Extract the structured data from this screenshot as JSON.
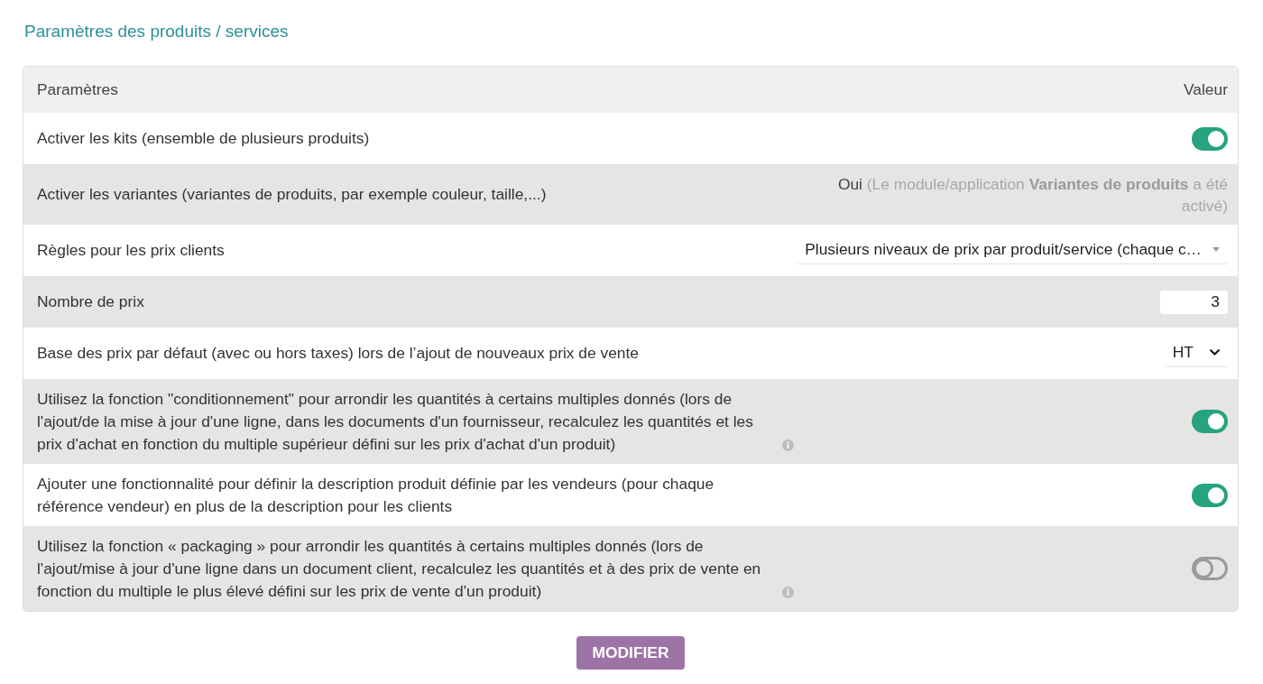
{
  "title": "Paramètres des produits / services",
  "table": {
    "columns": [
      "Paramètres",
      "Valeur"
    ],
    "rows": [
      {
        "kind": "toggle",
        "label": "Activer les kits (ensemble de plusieurs produits)",
        "on": true
      },
      {
        "kind": "status",
        "label": "Activer les variantes (variantes de produits, par exemple couleur, taille,...)",
        "value": "Oui",
        "note": "(Le module/application **Variantes de produits** a été activé)"
      },
      {
        "kind": "combobox",
        "label": "Règles pour les prix clients",
        "value": "Plusieurs niveaux de prix par produit/service (chaque c…"
      },
      {
        "kind": "number",
        "label": "Nombre de prix",
        "value": "3"
      },
      {
        "kind": "select",
        "label": "Base des prix par défaut (avec ou hors taxes) lors de l’ajout de nouveaux prix de vente",
        "value": "HT"
      },
      {
        "kind": "toggle",
        "label": "Utilisez la fonction \"conditionnement\" pour arrondir les quantités à certains multiples donnés (lors de l'ajout/de la mise à jour d'une ligne, dans les documents d'un fournisseur, recalculez les quantités et les prix d'achat en fonction du multiple supérieur défini sur les prix d'achat d'un produit)",
        "info": true,
        "on": true
      },
      {
        "kind": "toggle",
        "label": "Ajouter une fonctionnalité pour définir la description produit définie par les vendeurs (pour chaque référence vendeur) en plus de la description pour les clients",
        "on": true
      },
      {
        "kind": "toggle",
        "label": "Utilisez la fonction « packaging » pour arrondir les quantités à certains multiples donnés (lors de l'ajout/mise à jour d'une ligne dans un document client, recalculez les quantités et à des prix de vente en fonction du multiple le plus élevé défini sur les prix de vente d'un produit)",
        "info": true,
        "on": false
      }
    ]
  },
  "submit": "MODIFIER"
}
